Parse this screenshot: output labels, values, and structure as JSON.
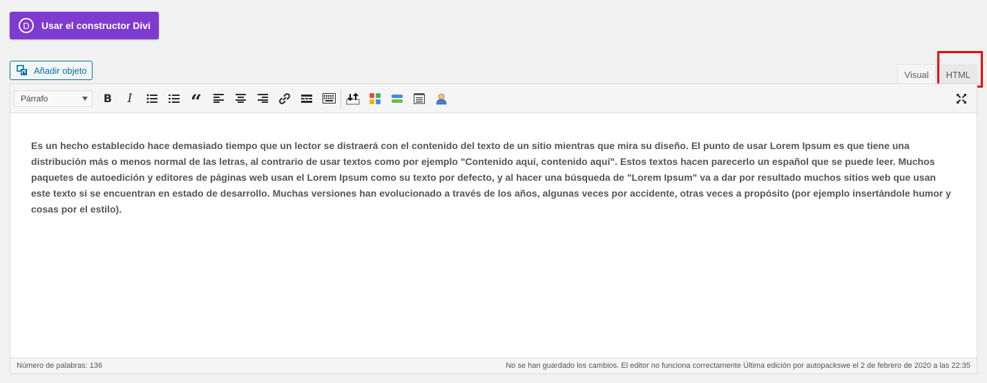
{
  "divi_button": {
    "label": "Usar el constructor Divi",
    "logo_letter": "D"
  },
  "add_media": {
    "label": "Añadir objeto"
  },
  "tabs": {
    "visual": "Visual",
    "html": "HTML"
  },
  "toolbar": {
    "format_select": {
      "value": "Párrafo"
    },
    "buttons": [
      {
        "name": "bold-button",
        "icon": "bold-icon",
        "glyph": "B"
      },
      {
        "name": "italic-button",
        "icon": "italic-icon",
        "glyph": "I"
      },
      {
        "name": "bullet-list-button",
        "icon": "bullet-list-icon"
      },
      {
        "name": "numbered-list-button",
        "icon": "numbered-list-icon"
      },
      {
        "name": "blockquote-button",
        "icon": "blockquote-icon",
        "glyph": "“"
      },
      {
        "name": "align-left-button",
        "icon": "align-left-icon"
      },
      {
        "name": "align-center-button",
        "icon": "align-center-icon"
      },
      {
        "name": "align-right-button",
        "icon": "align-right-icon"
      },
      {
        "name": "link-button",
        "icon": "link-icon"
      },
      {
        "name": "read-more-button",
        "icon": "read-more-icon"
      },
      {
        "name": "toolbar-toggle-button",
        "icon": "keyboard-icon"
      }
    ]
  },
  "editor": {
    "content": "Es un hecho establecido hace demasiado tiempo que un lector se distraerá con el contenido del texto de un sitio mientras que mira su diseño. El punto de usar Lorem Ipsum es que tiene una distribución más o menos normal de las letras, al contrario de usar textos como por ejemplo \"Contenido aquí, contenido aquí\". Estos textos hacen parecerlo un español que se puede leer. Muchos paquetes de autoedición y editores de páginas web usan el Lorem Ipsum como su texto por defecto, y al hacer una búsqueda de \"Lorem Ipsum\" va a dar por resultado muchos sitios web que usan este texto si se encuentran en estado de desarrollo. Muchas versiones han evolucionado a través de los años, algunas veces por accidente, otras veces a propósito (por ejemplo insertándole humor y cosas por el estilo)."
  },
  "statusbar": {
    "word_count": "Número de palabras: 136",
    "status": "No se han guardado los cambios. El editor no funciona correctamente Última edición por autopackswe el 2 de febrero de 2020 a las 22:35"
  },
  "colors": {
    "divi_purple": "#7e3bd0",
    "link_blue": "#0071a1",
    "highlight_red": "#e00000"
  }
}
